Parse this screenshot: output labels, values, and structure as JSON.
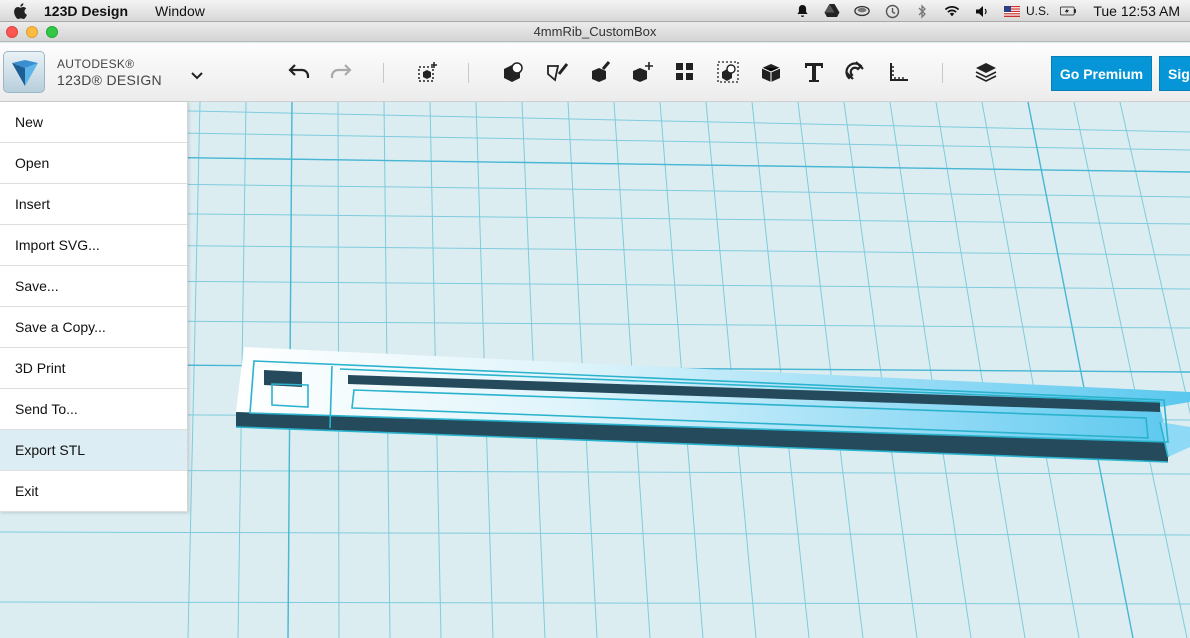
{
  "menubar": {
    "app_name": "123D Design",
    "menus": [
      "Window"
    ],
    "input_source": "U.S.",
    "clock": "Tue 12:53 AM"
  },
  "window": {
    "title": "4mmRib_CustomBox"
  },
  "brand": {
    "line1": "AUTODESK®",
    "line2": "123D® DESIGN"
  },
  "toolbar": {
    "icons": [
      "undo-icon",
      "redo-icon",
      "transform-icon",
      "primitives-icon",
      "sketch-icon",
      "construct-icon",
      "modify-icon",
      "pattern-icon",
      "grouping-icon",
      "combine-icon",
      "text-icon",
      "snap-icon",
      "measure-icon",
      "material-icon"
    ],
    "premium_label": "Go Premium",
    "signin_label": "Sig"
  },
  "file_menu": {
    "items": [
      "New",
      "Open",
      "Insert",
      "Import SVG...",
      "Save...",
      "Save a Copy...",
      "3D Print",
      "Send To...",
      "Export STL",
      "Exit"
    ],
    "highlighted": "Export STL"
  },
  "colors": {
    "accent": "#0696d7",
    "grid": "#7fcbdc",
    "model": "#5ac8ee",
    "highlight": "#dcedf3"
  }
}
